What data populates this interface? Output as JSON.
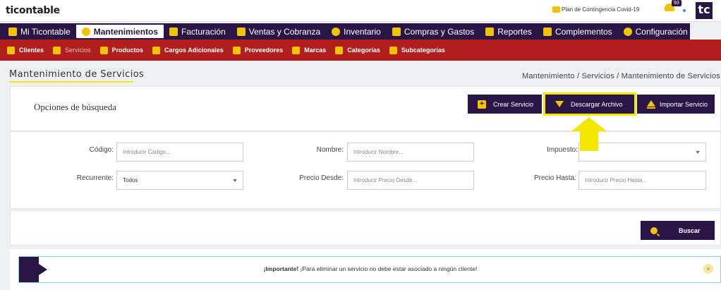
{
  "header": {
    "logo": "ticontable",
    "contingency": "Plan de Contingencia Covid-19",
    "notifications": "93",
    "brand": "tc"
  },
  "main_nav": [
    {
      "label": "Mi Ticontable",
      "icon": "home-icon"
    },
    {
      "label": "Mantenimientos",
      "icon": "gear-icon",
      "active": true
    },
    {
      "label": "Facturación",
      "icon": "invoice-icon"
    },
    {
      "label": "Ventas y Cobranza",
      "icon": "sales-icon"
    },
    {
      "label": "Inventario",
      "icon": "inventory-icon"
    },
    {
      "label": "Compras y Gastos",
      "icon": "cart-icon"
    },
    {
      "label": "Reportes",
      "icon": "reports-icon"
    },
    {
      "label": "Complementos",
      "icon": "plus-icon"
    },
    {
      "label": "Configuración",
      "icon": "settings-icon"
    }
  ],
  "sub_nav": [
    {
      "label": "Clientes",
      "icon": "clients-icon"
    },
    {
      "label": "Servicios",
      "icon": "services-icon",
      "active": true
    },
    {
      "label": "Productos",
      "icon": "products-icon"
    },
    {
      "label": "Cargos Adicionales",
      "icon": "charges-icon"
    },
    {
      "label": "Proveedores",
      "icon": "suppliers-icon"
    },
    {
      "label": "Marcas",
      "icon": "flag-icon"
    },
    {
      "label": "Categorías",
      "icon": "categories-icon"
    },
    {
      "label": "Subcategorías",
      "icon": "subcategories-icon"
    }
  ],
  "page": {
    "title": "Mantenimiento de Servicios",
    "breadcrumb": "Mantenimiento / Servicios / Mantenimiento de Servicios"
  },
  "options": {
    "title": "Opciones de búsqueda",
    "crear": "Crear Servicio",
    "descargar": "Descargar Archivo",
    "importar": "Importar Servicio"
  },
  "form": {
    "codigo_label": "Código:",
    "codigo_placeholder": "Introducir Código...",
    "nombre_label": "Nombre:",
    "nombre_placeholder": "Introducir Nombre...",
    "impuesto_label": "Impuesto:",
    "impuesto_value": "",
    "recurrente_label": "Recurrente:",
    "recurrente_value": "Todos",
    "precio_desde_label": "Precio Desde:",
    "precio_desde_placeholder": "Introducir Precio Desde...",
    "precio_hasta_label": "Precio Hasta:",
    "precio_hasta_placeholder": "Introducir Precio Hasta..."
  },
  "search": {
    "buscar": "Buscar"
  },
  "alert": {
    "strong": "¡Importante!",
    "text": " ¡Para eliminar un servicio no debe estar asociado a ningún cliente!",
    "close": "×"
  },
  "colors": {
    "primary": "#2a1646",
    "subnav": "#b01e1e",
    "accent": "#f2c400",
    "highlight": "#f5e800"
  }
}
